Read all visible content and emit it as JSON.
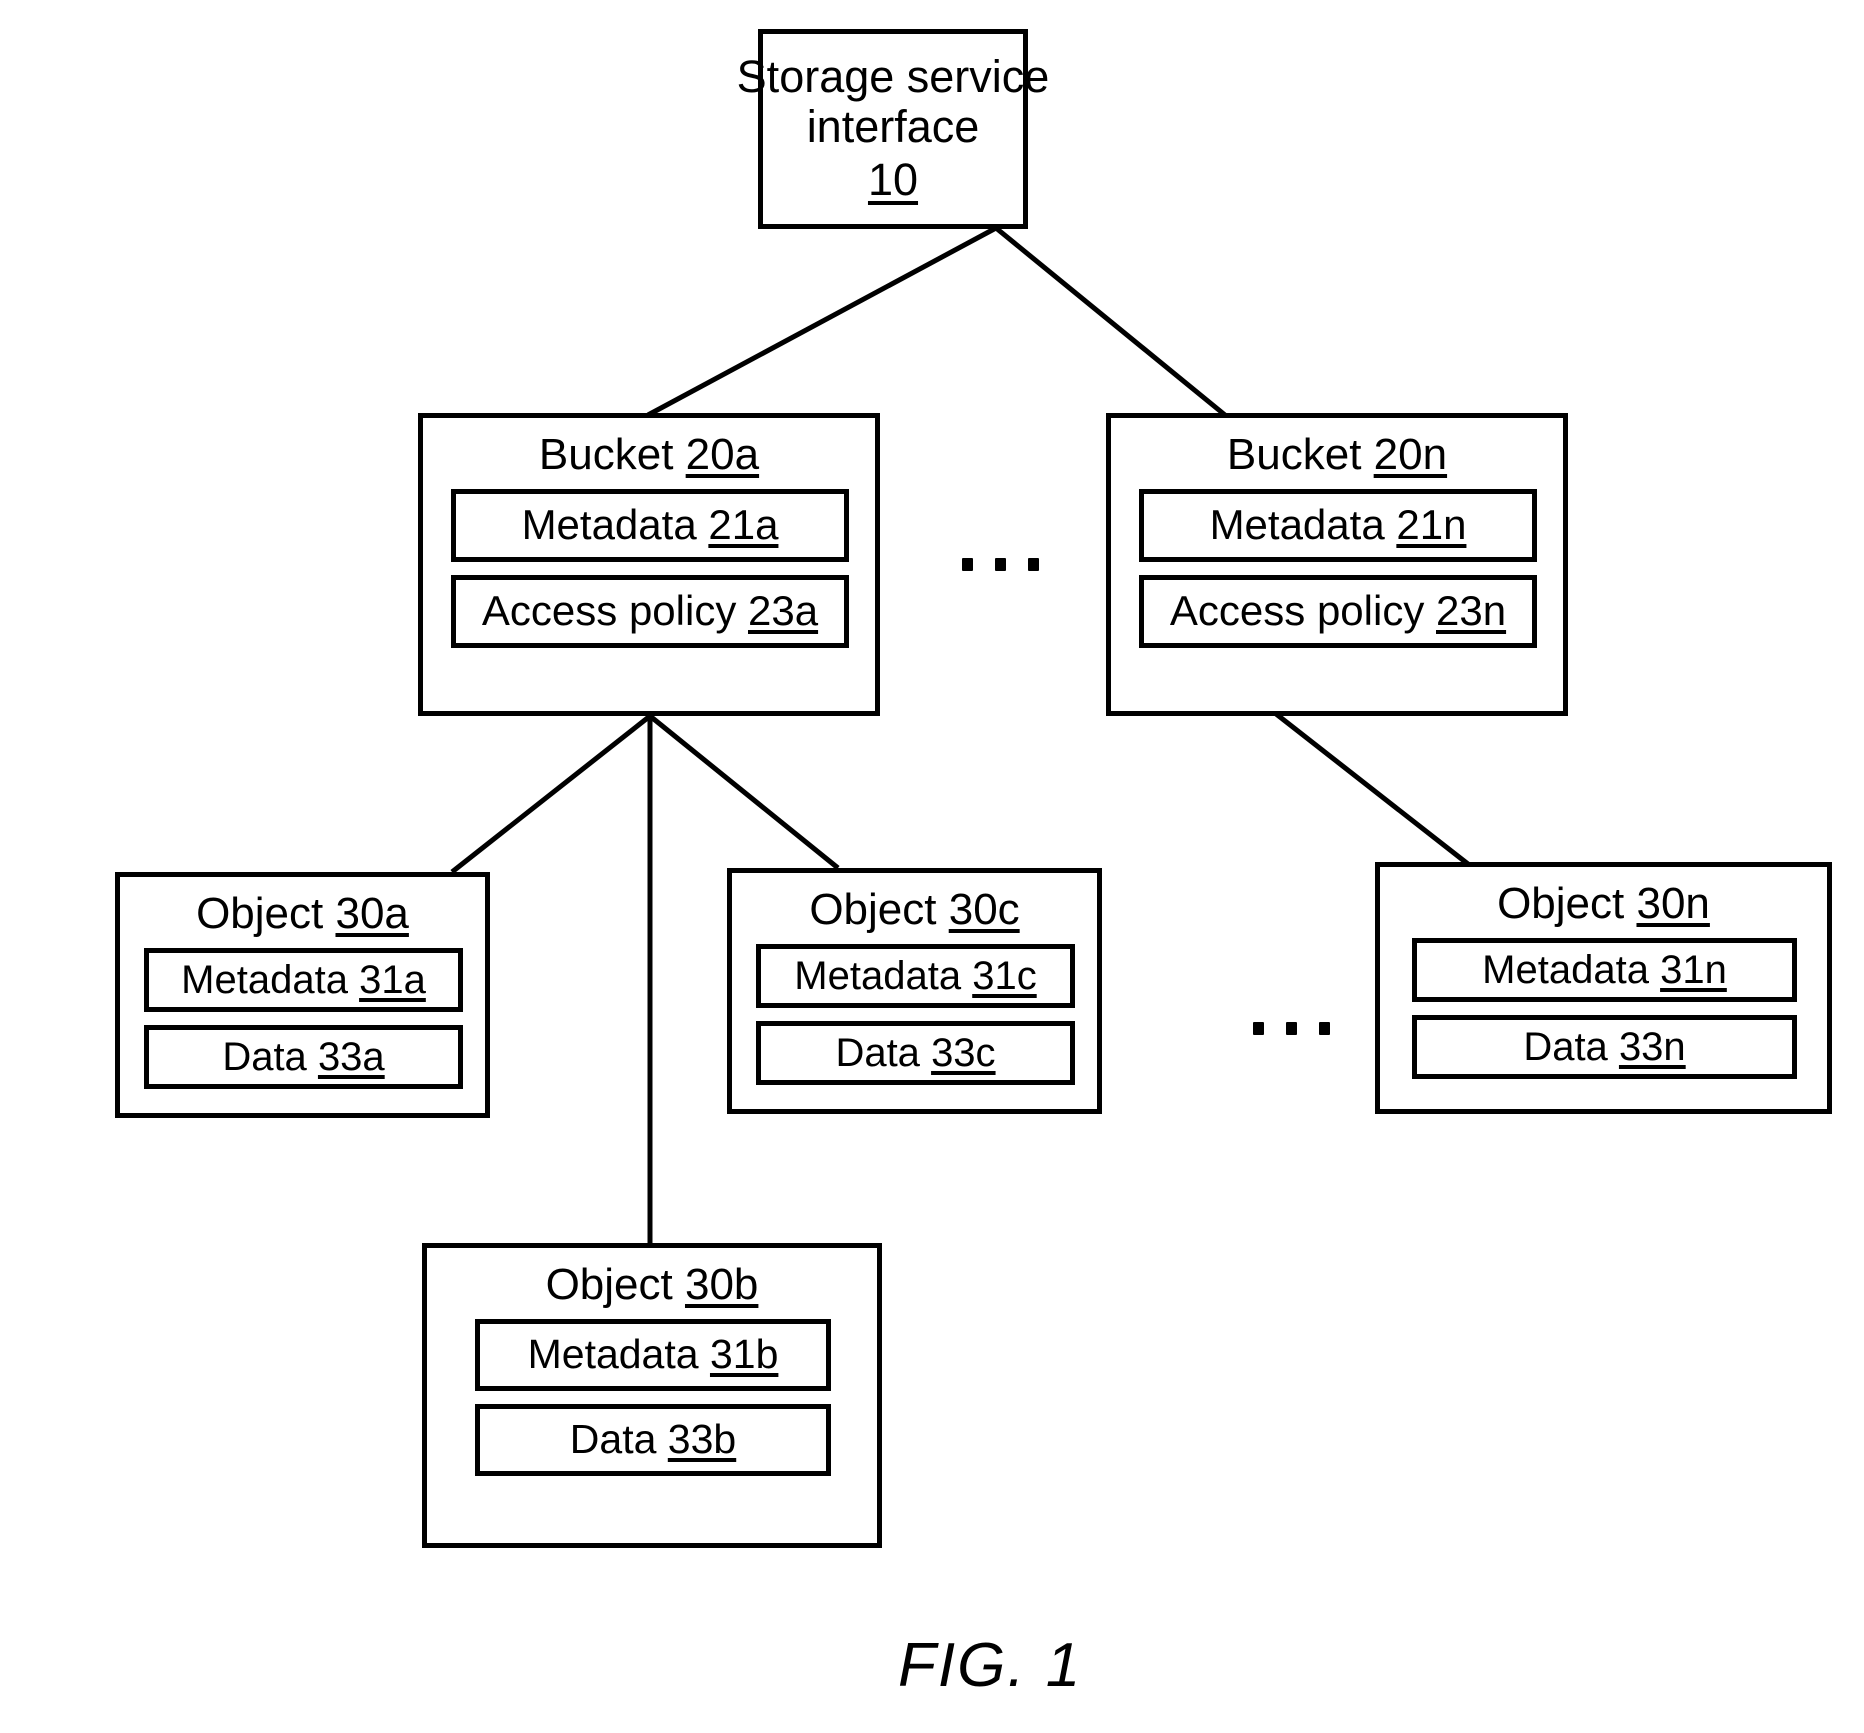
{
  "figure": {
    "caption": "FIG. 1"
  },
  "interface": {
    "name": "interface-node",
    "line1": "Storage service",
    "line2": "interface",
    "ref": "10"
  },
  "buckets": [
    {
      "id": "bucket-20a",
      "title_label": "Bucket",
      "title_ref": "20a",
      "rows": [
        {
          "id": "metadata-21a",
          "label": "Metadata",
          "ref": "21a"
        },
        {
          "id": "access-policy-23a",
          "label": "Access policy",
          "ref": "23a"
        }
      ]
    },
    {
      "id": "bucket-20n",
      "title_label": "Bucket",
      "title_ref": "20n",
      "rows": [
        {
          "id": "metadata-21n",
          "label": "Metadata",
          "ref": "21n"
        },
        {
          "id": "access-policy-23n",
          "label": "Access policy",
          "ref": "23n"
        }
      ]
    }
  ],
  "objects": [
    {
      "id": "object-30a",
      "title_label": "Object",
      "title_ref": "30a",
      "rows": [
        {
          "id": "metadata-31a",
          "label": "Metadata",
          "ref": "31a"
        },
        {
          "id": "data-33a",
          "label": "Data",
          "ref": "33a"
        }
      ]
    },
    {
      "id": "object-30c",
      "title_label": "Object",
      "title_ref": "30c",
      "rows": [
        {
          "id": "metadata-31c",
          "label": "Metadata",
          "ref": "31c"
        },
        {
          "id": "data-33c",
          "label": "Data",
          "ref": "33c"
        }
      ]
    },
    {
      "id": "object-30n",
      "title_label": "Object",
      "title_ref": "30n",
      "rows": [
        {
          "id": "metadata-31n",
          "label": "Metadata",
          "ref": "31n"
        },
        {
          "id": "data-33n",
          "label": "Data",
          "ref": "33n"
        }
      ]
    },
    {
      "id": "object-30b",
      "title_label": "Object",
      "title_ref": "30b",
      "rows": [
        {
          "id": "metadata-31b",
          "label": "Metadata",
          "ref": "31b"
        },
        {
          "id": "data-33b",
          "label": "Data",
          "ref": "33b"
        }
      ]
    }
  ],
  "ellipses": [
    {
      "id": "bucket-row-ellipsis",
      "dots": 3
    },
    {
      "id": "object-row-ellipsis",
      "dots": 3
    }
  ],
  "colors": {
    "ink": "#000000",
    "paper": "#ffffff"
  }
}
